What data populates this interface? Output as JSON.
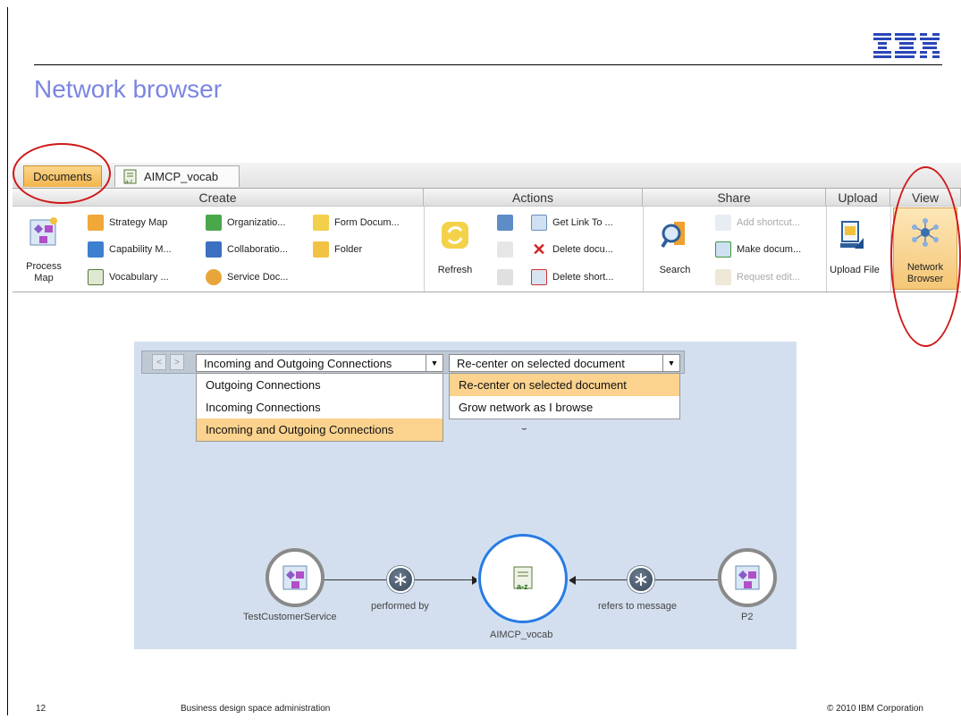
{
  "slide": {
    "title": "Network browser",
    "logo": "IBM",
    "footer": {
      "page": "12",
      "course": "Business design space administration",
      "copyright": "© 2010 IBM Corporation"
    }
  },
  "ribbon": {
    "tabs": [
      {
        "label": "Documents",
        "active": true
      },
      {
        "label": "AIMCP_vocab",
        "icon": "vocabulary-icon",
        "active": false
      }
    ],
    "groups": {
      "create": {
        "title": "Create",
        "big": {
          "label_line1": "Process",
          "label_line2": "Map",
          "icon": "process-map-icon"
        },
        "items": [
          {
            "label": "Strategy Map",
            "icon": "strategy-map-icon"
          },
          {
            "label": "Capability M...",
            "icon": "capability-map-icon"
          },
          {
            "label": "Vocabulary ...",
            "icon": "vocabulary-icon"
          },
          {
            "label": "Organizatio...",
            "icon": "organization-icon"
          },
          {
            "label": "Collaboratio...",
            "icon": "collaboration-icon"
          },
          {
            "label": "Service Doc...",
            "icon": "service-doc-icon"
          },
          {
            "label": "Form Docum...",
            "icon": "form-doc-icon"
          },
          {
            "label": "Folder",
            "icon": "folder-icon"
          }
        ]
      },
      "actions": {
        "title": "Actions",
        "refresh": {
          "label": "Refresh",
          "icon": "refresh-icon"
        },
        "items": [
          {
            "label": "Get Link To ...",
            "icon": "link-icon"
          },
          {
            "label": "Delete docu...",
            "icon": "delete-icon"
          },
          {
            "label": "Delete short...",
            "icon": "delete-shortcut-icon"
          }
        ]
      },
      "share": {
        "title": "Share",
        "search": {
          "label": "Search",
          "icon": "search-icon"
        },
        "items": [
          {
            "label": "Add shortcut...",
            "icon": "add-shortcut-icon",
            "enabled": false
          },
          {
            "label": "Make docum...",
            "icon": "make-document-icon",
            "enabled": true
          },
          {
            "label": "Request edit...",
            "icon": "request-edit-icon",
            "enabled": false
          }
        ]
      },
      "upload": {
        "title": "Upload",
        "button": {
          "label": "Upload File",
          "icon": "upload-icon"
        }
      },
      "view": {
        "title": "View",
        "button": {
          "label_line1": "Network",
          "label_line2": "Browser",
          "icon": "network-icon"
        }
      }
    }
  },
  "network_browser": {
    "nav": {
      "back": "<",
      "forward": ">"
    },
    "connections_select": {
      "value": "Incoming and Outgoing Connections",
      "options": [
        "Outgoing Connections",
        "Incoming Connections",
        "Incoming and Outgoing Connections"
      ],
      "selected_index": 2
    },
    "mode_select": {
      "value": "Re-center on selected document",
      "options": [
        "Re-center on selected document",
        "Grow network as I browse"
      ],
      "selected_index": 0
    },
    "graph": {
      "nodes": [
        {
          "label": "TestCustomerService",
          "icon": "process-map-icon"
        },
        {
          "label": "AIMCP_vocab",
          "icon": "vocabulary-icon",
          "selected": true
        },
        {
          "label": "P2",
          "icon": "process-map-icon"
        }
      ],
      "edges": [
        {
          "label": "performed by",
          "icon": "relation-star-icon"
        },
        {
          "label": "refers to message",
          "icon": "relation-star-icon"
        }
      ]
    }
  },
  "colors": {
    "title_blue": "#7b86e0",
    "callout_red": "#d01818",
    "tab_orange": "#f3b54d",
    "panel_bg": "#d3dfee",
    "selected_ring": "#2a7be0"
  }
}
